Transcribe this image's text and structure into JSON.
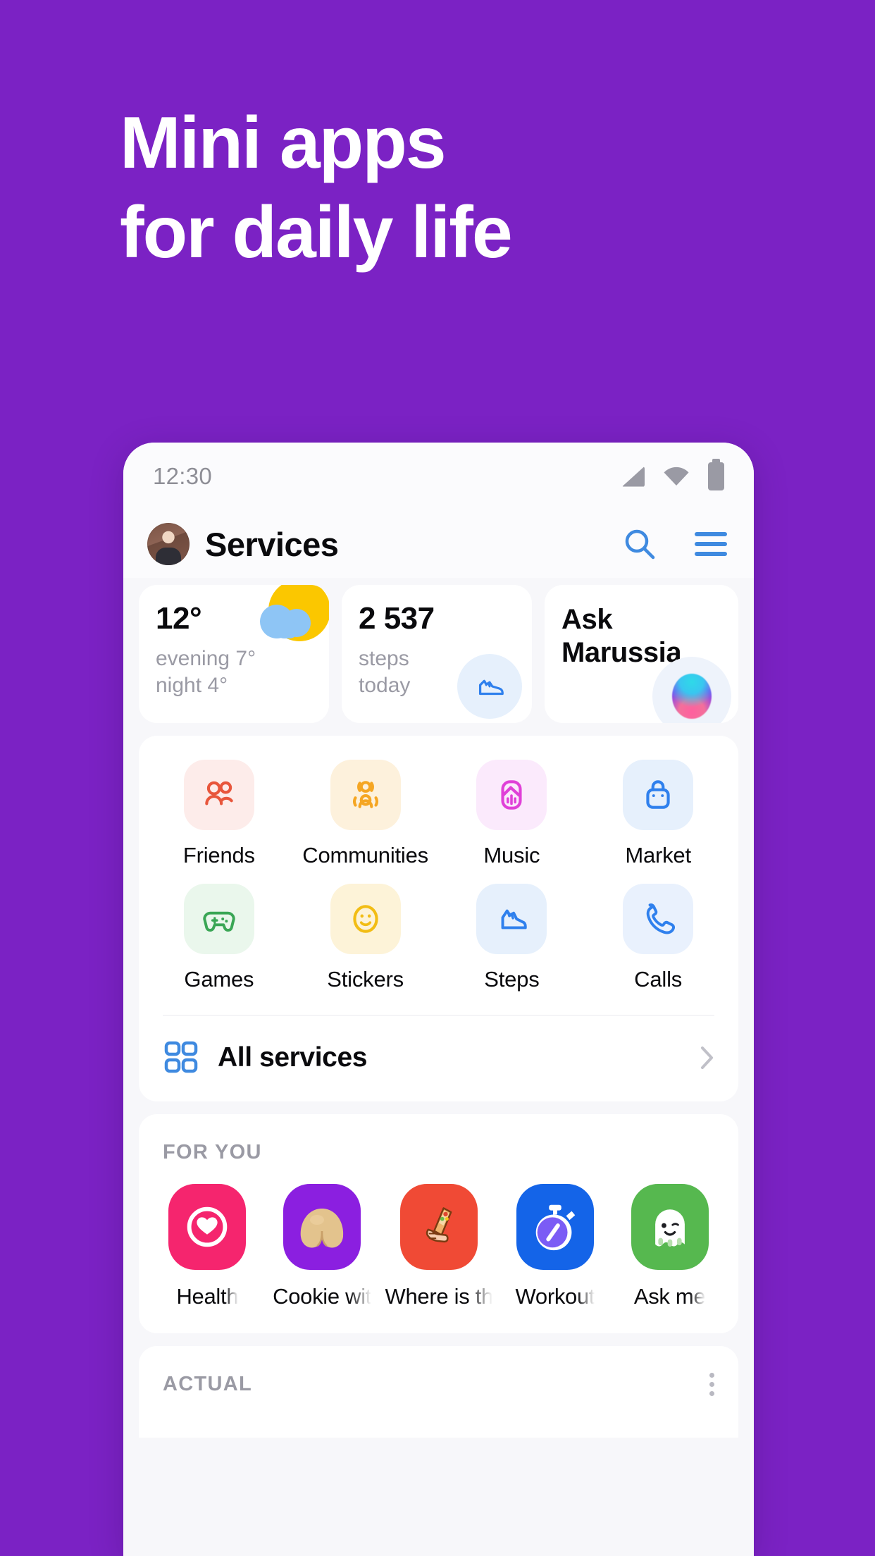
{
  "theme": {
    "background": "#7b22c4",
    "accent_blue": "#3f8ae0",
    "text_primary": "#0a0a0d",
    "text_muted": "#9a9aa4"
  },
  "promo": {
    "line1": "Mini apps",
    "line2": "for daily life"
  },
  "phone": {
    "status_bar": {
      "time": "12:30",
      "icons": [
        "signal-icon",
        "wifi-icon",
        "battery-icon"
      ]
    },
    "app_bar": {
      "title": "Services",
      "avatar": "user-avatar",
      "search_icon": "search-icon",
      "menu_icon": "hamburger-menu-icon"
    },
    "widgets": [
      {
        "id": "weather",
        "value": "12°",
        "sub_line1": "evening 7°",
        "sub_line2": "night 4°",
        "icon": "sun-cloud-icon"
      },
      {
        "id": "steps",
        "value": "2 537",
        "sub_line1": "steps",
        "sub_line2": "today",
        "icon": "sneaker-icon"
      },
      {
        "id": "assistant",
        "title_line1": "Ask",
        "title_line2": "Marussia",
        "icon": "assistant-orb-icon"
      }
    ],
    "services": [
      {
        "label": "Friends",
        "icon": "friends-icon",
        "tile_bg": "#fdecea",
        "icon_color": "#e8563c"
      },
      {
        "label": "Communities",
        "icon": "communities-icon",
        "tile_bg": "#fdf1dc",
        "icon_color": "#f5a623"
      },
      {
        "label": "Music",
        "icon": "music-icon",
        "tile_bg": "#fbeafc",
        "icon_color": "#e040d8"
      },
      {
        "label": "Market",
        "icon": "market-bag-icon",
        "tile_bg": "#e6f0fc",
        "icon_color": "#2f80ed"
      },
      {
        "label": "Games",
        "icon": "gamepad-icon",
        "tile_bg": "#eaf7ec",
        "icon_color": "#3aa655"
      },
      {
        "label": "Stickers",
        "icon": "smiley-icon",
        "tile_bg": "#fdf3d8",
        "icon_color": "#f2bd15"
      },
      {
        "label": "Steps",
        "icon": "sneaker-icon",
        "tile_bg": "#e6f0fc",
        "icon_color": "#2f80ed"
      },
      {
        "label": "Calls",
        "icon": "phone-icon",
        "tile_bg": "#e9f1fd",
        "icon_color": "#2f80ed"
      }
    ],
    "all_services": {
      "label": "All services",
      "icon": "grid-4-icon",
      "chevron": "chevron-right-icon"
    },
    "for_you": {
      "section_title": "FOR YOU",
      "menu_icon": "kebab-menu-icon",
      "items": [
        {
          "label": "Health",
          "icon": "heart-target-icon",
          "tile_bg": "#f5256e"
        },
        {
          "label": "Cookie wit",
          "icon": "fortune-cookie-icon",
          "tile_bg": "#8b1fe0"
        },
        {
          "label": "Where is th",
          "icon": "shawarma-hand-icon",
          "tile_bg": "#f04a35"
        },
        {
          "label": "Workout",
          "icon": "stopwatch-icon",
          "tile_bg": "#1464e8"
        },
        {
          "label": "Ask me",
          "icon": "ghost-icon",
          "tile_bg": "#56b84f"
        }
      ]
    },
    "actual": {
      "section_title": "ACTUAL",
      "menu_icon": "kebab-menu-icon"
    }
  }
}
